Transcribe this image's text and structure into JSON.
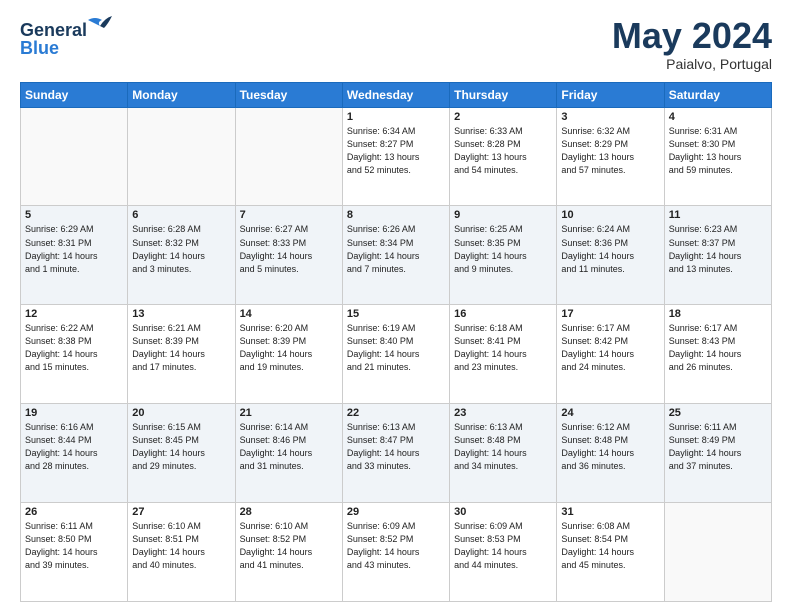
{
  "logo": {
    "line1": "General",
    "line2": "Blue"
  },
  "title": "May 2024",
  "location": "Paialvo, Portugal",
  "weekdays": [
    "Sunday",
    "Monday",
    "Tuesday",
    "Wednesday",
    "Thursday",
    "Friday",
    "Saturday"
  ],
  "weeks": [
    [
      {
        "day": "",
        "info": ""
      },
      {
        "day": "",
        "info": ""
      },
      {
        "day": "",
        "info": ""
      },
      {
        "day": "1",
        "info": "Sunrise: 6:34 AM\nSunset: 8:27 PM\nDaylight: 13 hours\nand 52 minutes."
      },
      {
        "day": "2",
        "info": "Sunrise: 6:33 AM\nSunset: 8:28 PM\nDaylight: 13 hours\nand 54 minutes."
      },
      {
        "day": "3",
        "info": "Sunrise: 6:32 AM\nSunset: 8:29 PM\nDaylight: 13 hours\nand 57 minutes."
      },
      {
        "day": "4",
        "info": "Sunrise: 6:31 AM\nSunset: 8:30 PM\nDaylight: 13 hours\nand 59 minutes."
      }
    ],
    [
      {
        "day": "5",
        "info": "Sunrise: 6:29 AM\nSunset: 8:31 PM\nDaylight: 14 hours\nand 1 minute."
      },
      {
        "day": "6",
        "info": "Sunrise: 6:28 AM\nSunset: 8:32 PM\nDaylight: 14 hours\nand 3 minutes."
      },
      {
        "day": "7",
        "info": "Sunrise: 6:27 AM\nSunset: 8:33 PM\nDaylight: 14 hours\nand 5 minutes."
      },
      {
        "day": "8",
        "info": "Sunrise: 6:26 AM\nSunset: 8:34 PM\nDaylight: 14 hours\nand 7 minutes."
      },
      {
        "day": "9",
        "info": "Sunrise: 6:25 AM\nSunset: 8:35 PM\nDaylight: 14 hours\nand 9 minutes."
      },
      {
        "day": "10",
        "info": "Sunrise: 6:24 AM\nSunset: 8:36 PM\nDaylight: 14 hours\nand 11 minutes."
      },
      {
        "day": "11",
        "info": "Sunrise: 6:23 AM\nSunset: 8:37 PM\nDaylight: 14 hours\nand 13 minutes."
      }
    ],
    [
      {
        "day": "12",
        "info": "Sunrise: 6:22 AM\nSunset: 8:38 PM\nDaylight: 14 hours\nand 15 minutes."
      },
      {
        "day": "13",
        "info": "Sunrise: 6:21 AM\nSunset: 8:39 PM\nDaylight: 14 hours\nand 17 minutes."
      },
      {
        "day": "14",
        "info": "Sunrise: 6:20 AM\nSunset: 8:39 PM\nDaylight: 14 hours\nand 19 minutes."
      },
      {
        "day": "15",
        "info": "Sunrise: 6:19 AM\nSunset: 8:40 PM\nDaylight: 14 hours\nand 21 minutes."
      },
      {
        "day": "16",
        "info": "Sunrise: 6:18 AM\nSunset: 8:41 PM\nDaylight: 14 hours\nand 23 minutes."
      },
      {
        "day": "17",
        "info": "Sunrise: 6:17 AM\nSunset: 8:42 PM\nDaylight: 14 hours\nand 24 minutes."
      },
      {
        "day": "18",
        "info": "Sunrise: 6:17 AM\nSunset: 8:43 PM\nDaylight: 14 hours\nand 26 minutes."
      }
    ],
    [
      {
        "day": "19",
        "info": "Sunrise: 6:16 AM\nSunset: 8:44 PM\nDaylight: 14 hours\nand 28 minutes."
      },
      {
        "day": "20",
        "info": "Sunrise: 6:15 AM\nSunset: 8:45 PM\nDaylight: 14 hours\nand 29 minutes."
      },
      {
        "day": "21",
        "info": "Sunrise: 6:14 AM\nSunset: 8:46 PM\nDaylight: 14 hours\nand 31 minutes."
      },
      {
        "day": "22",
        "info": "Sunrise: 6:13 AM\nSunset: 8:47 PM\nDaylight: 14 hours\nand 33 minutes."
      },
      {
        "day": "23",
        "info": "Sunrise: 6:13 AM\nSunset: 8:48 PM\nDaylight: 14 hours\nand 34 minutes."
      },
      {
        "day": "24",
        "info": "Sunrise: 6:12 AM\nSunset: 8:48 PM\nDaylight: 14 hours\nand 36 minutes."
      },
      {
        "day": "25",
        "info": "Sunrise: 6:11 AM\nSunset: 8:49 PM\nDaylight: 14 hours\nand 37 minutes."
      }
    ],
    [
      {
        "day": "26",
        "info": "Sunrise: 6:11 AM\nSunset: 8:50 PM\nDaylight: 14 hours\nand 39 minutes."
      },
      {
        "day": "27",
        "info": "Sunrise: 6:10 AM\nSunset: 8:51 PM\nDaylight: 14 hours\nand 40 minutes."
      },
      {
        "day": "28",
        "info": "Sunrise: 6:10 AM\nSunset: 8:52 PM\nDaylight: 14 hours\nand 41 minutes."
      },
      {
        "day": "29",
        "info": "Sunrise: 6:09 AM\nSunset: 8:52 PM\nDaylight: 14 hours\nand 43 minutes."
      },
      {
        "day": "30",
        "info": "Sunrise: 6:09 AM\nSunset: 8:53 PM\nDaylight: 14 hours\nand 44 minutes."
      },
      {
        "day": "31",
        "info": "Sunrise: 6:08 AM\nSunset: 8:54 PM\nDaylight: 14 hours\nand 45 minutes."
      },
      {
        "day": "",
        "info": ""
      }
    ]
  ]
}
